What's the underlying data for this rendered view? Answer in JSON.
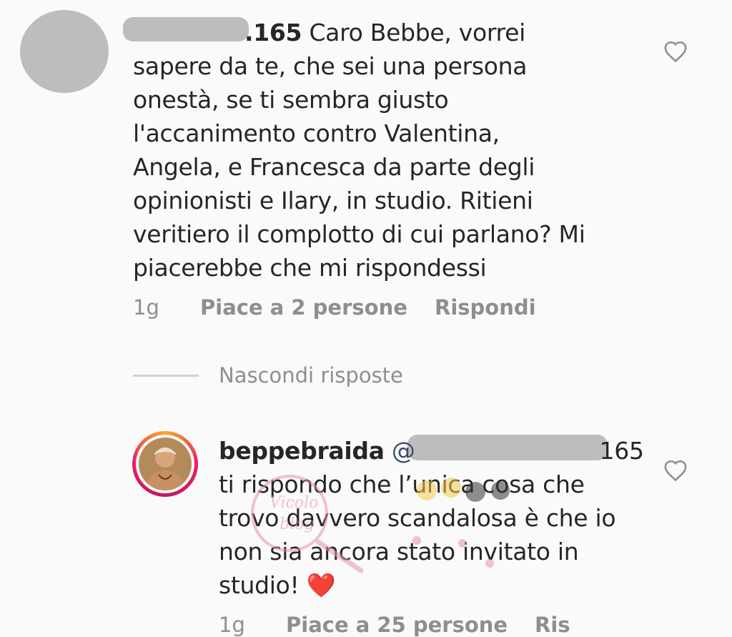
{
  "comment1": {
    "username": ".165",
    "text": "Caro Bebbe, vorrei sapere da te, che sei una persona onestà, se ti sembra giusto l'accanimento contro Valentina, Angela, e Francesca da parte degli opinionisti e Ilary, in studio. Ritieni veritiero il complotto di cui parlano? Mi piacerebbe che mi rispondessi",
    "time": "1g",
    "likes": "Piace a 2 persone",
    "reply": "Rispondi",
    "like_icon": "heart-outline-icon"
  },
  "hide_replies": "Nascondi risposte",
  "reply1": {
    "username": "beppebraida",
    "mention": "@",
    "mention_partial": "165 ti",
    "text": "rispondo che l’unica cosa che trovo davvero scandalosa è che io non sia ancora stato invitato in studio!",
    "emoji": "❤️",
    "time": "1g",
    "likes": "Piace a 25 persone",
    "reply": "Ris",
    "like_icon": "heart-outline-icon",
    "story_ring_colors": [
      "#f9a825",
      "#e91e63"
    ]
  },
  "colors": {
    "text": "#262626",
    "secondary": "#8e8e8e",
    "background": "#fafafa"
  }
}
